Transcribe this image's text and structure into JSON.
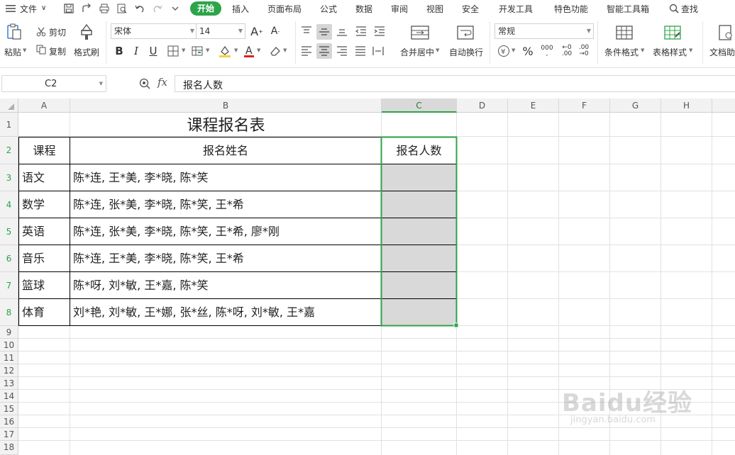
{
  "menu": {
    "file": "文件",
    "tabs": [
      "开始",
      "插入",
      "页面布局",
      "公式",
      "数据",
      "审阅",
      "视图",
      "安全",
      "开发工具",
      "特色功能",
      "智能工具箱"
    ],
    "search": "查找"
  },
  "ribbon": {
    "paste": "粘贴",
    "cut": "剪切",
    "copy": "复制",
    "format_painter": "格式刷",
    "font_name": "宋体",
    "font_size": "14",
    "merge_center": "合并居中",
    "wrap_text": "自动换行",
    "number_format": "常规",
    "conditional_format": "条件格式",
    "table_style": "表格样式",
    "doc_assist": "文档助"
  },
  "formula_bar": {
    "name_box": "C2",
    "fx": "fx",
    "content": "报名人数"
  },
  "sheet": {
    "columns": [
      "A",
      "B",
      "C",
      "D",
      "E",
      "F",
      "G",
      "H"
    ],
    "rows": [
      "1",
      "2",
      "3",
      "4",
      "5",
      "6",
      "7",
      "8",
      "9",
      "10",
      "11",
      "12",
      "13",
      "14",
      "15",
      "16",
      "17",
      "18"
    ],
    "title": "课程报名表",
    "header": {
      "course": "课程",
      "names": "报名姓名",
      "count": "报名人数"
    },
    "data": [
      {
        "course": "语文",
        "names": "陈*连, 王*美, 李*晓, 陈*笑"
      },
      {
        "course": "数学",
        "names": "陈*连, 张*美, 李*晓, 陈*笑, 王*希"
      },
      {
        "course": "英语",
        "names": "陈*连, 张*美, 李*晓, 陈*笑, 王*希, 廖*刚"
      },
      {
        "course": "音乐",
        "names": "陈*连, 王*美, 李*晓, 陈*笑, 王*希"
      },
      {
        "course": "篮球",
        "names": "陈*呀, 刘*敏, 王*嘉, 陈*笑"
      },
      {
        "course": "体育",
        "names": "刘*艳, 刘*敏, 王*娜, 张*丝, 陈*呀, 刘*敏, 王*嘉"
      }
    ]
  },
  "watermark": {
    "brand": "Baidu经验",
    "url": "jingyan.baidu.com"
  },
  "colors": {
    "accent": "#2ca44a",
    "selection": "#d9d9d9"
  }
}
